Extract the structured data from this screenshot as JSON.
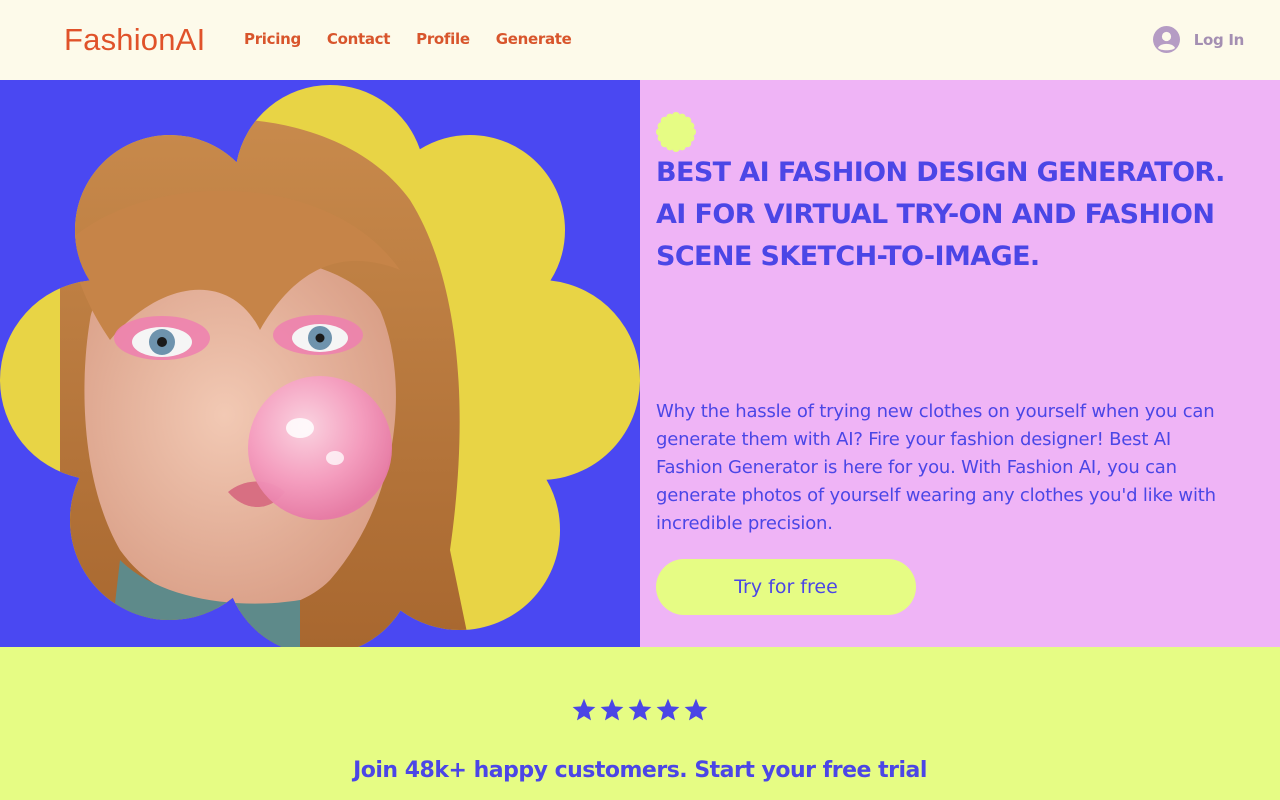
{
  "header": {
    "logo": "FashionAI",
    "nav": [
      "Pricing",
      "Contact",
      "Profile",
      "Generate"
    ],
    "login_label": "Log In"
  },
  "hero": {
    "headline": "BEST AI FASHION DESIGN GENERATOR.  AI FOR VIRTUAL TRY-ON AND FASHION SCENE SKETCH-TO-IMAGE.",
    "description": "Why the hassle of trying new clothes on yourself when you can generate them with AI? Fire your fashion designer! Best AI Fashion Generator is here for you. With Fashion AI, you can generate photos of yourself wearing any clothes you'd like with incredible precision.",
    "cta_label": "Try for free"
  },
  "reviews": {
    "rating": 5,
    "tagline": "Join 48k+ happy customers. Start your free trial"
  },
  "colors": {
    "brand": "#e0522a",
    "accent_blue": "#4b46e6",
    "lime": "#e6fc84",
    "pink": "#efb4f6",
    "flower_yellow": "#e8d445"
  },
  "icons": [
    "user-avatar-icon",
    "sun-flower-icon",
    "star-icon"
  ]
}
